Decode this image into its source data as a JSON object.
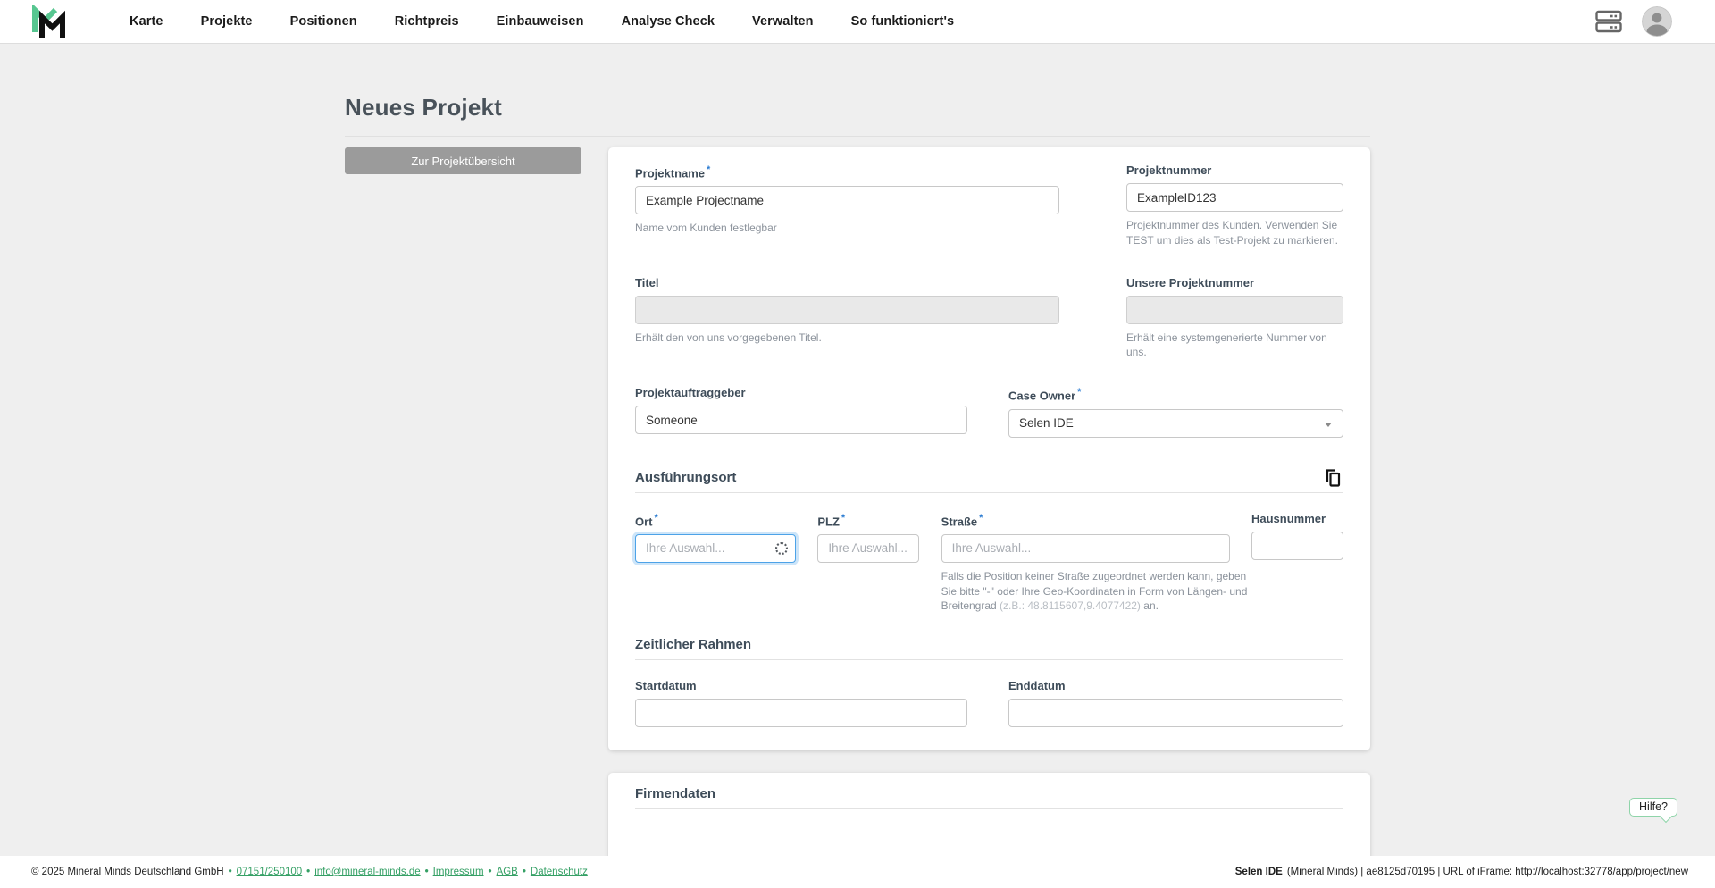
{
  "colors": {
    "accent_green": "#57C690",
    "link_green": "#35A065",
    "focus_blue": "#4DA3E8",
    "required_blue": "#2D7DD2",
    "button_gray": "#9B9B9B"
  },
  "ui": {
    "required_marker": "*"
  },
  "nav": {
    "items": [
      "Karte",
      "Projekte",
      "Positionen",
      "Richtpreis",
      "Einbauweisen",
      "Analyse Check",
      "Verwalten",
      "So funktioniert's"
    ]
  },
  "page": {
    "title": "Neues Projekt",
    "back_button_label": "Zur Projektübersicht",
    "help_button_label": "Hilfe?"
  },
  "form": {
    "projektname": {
      "label": "Projektname",
      "value": "Example Projectname",
      "help": "Name vom Kunden festlegbar"
    },
    "projektnummer": {
      "label": "Projektnummer",
      "value": "ExampleID123",
      "help": "Projektnummer des Kunden. Verwenden Sie TEST um dies als Test-Projekt zu markieren."
    },
    "titel": {
      "label": "Titel",
      "value": "",
      "help": "Erhält den von uns vorgegebenen Titel."
    },
    "unsere_projektnummer": {
      "label": "Unsere Projektnummer",
      "value": "",
      "help": "Erhält eine systemgenerierte Nummer von uns."
    },
    "projektauftraggeber": {
      "label": "Projektauftraggeber",
      "value": "Someone"
    },
    "case_owner": {
      "label": "Case Owner",
      "value": "Selen IDE"
    },
    "section_ausfuehrungsort": "Ausführungsort",
    "ort": {
      "label": "Ort",
      "placeholder": "Ihre Auswahl..."
    },
    "plz": {
      "label": "PLZ",
      "placeholder": "Ihre Auswahl..."
    },
    "strasse": {
      "label": "Straße",
      "placeholder": "Ihre Auswahl...",
      "help_main": "Falls die Position keiner Straße zugeordnet werden kann, geben Sie bitte \"-\" oder Ihre Geo-Koordinaten in Form von Längen- und Breitengrad ",
      "help_example": "(z.B.: 48.8115607,9.4077422)",
      "help_suffix": " an."
    },
    "hausnummer": {
      "label": "Hausnummer"
    },
    "section_zeitlicher_rahmen": "Zeitlicher Rahmen",
    "startdatum": {
      "label": "Startdatum"
    },
    "enddatum": {
      "label": "Enddatum"
    },
    "section_firmendaten": "Firmendaten"
  },
  "footer": {
    "copyright": "© 2025 Mineral Minds Deutschland GmbH",
    "separator": "•",
    "links": [
      "07151/250100",
      "info@mineral-minds.de",
      "Impressum",
      "AGB",
      "Datenschutz"
    ],
    "session_user": "Selen IDE",
    "session_rest": "(Mineral Minds) | ae8125d70195 | URL of iFrame: http://localhost:32778/app/project/new"
  }
}
